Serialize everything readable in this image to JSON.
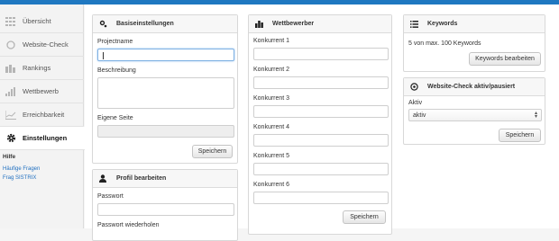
{
  "sidebar": {
    "items": [
      {
        "label": "Übersicht",
        "icon": "grid-icon"
      },
      {
        "label": "Website-Check",
        "icon": "circle-icon"
      },
      {
        "label": "Rankings",
        "icon": "bars-icon"
      },
      {
        "label": "Wettbewerb",
        "icon": "column-chart-icon"
      },
      {
        "label": "Erreichbarkeit",
        "icon": "line-chart-icon"
      },
      {
        "label": "Einstellungen",
        "icon": "gear-icon"
      }
    ],
    "help_heading": "Hilfe",
    "help_links": [
      "Häufige Fragen",
      "Frag SISTRIX"
    ]
  },
  "basis": {
    "title": "Basiseinstellungen",
    "projectname_label": "Projectname",
    "beschreibung_label": "Beschreibung",
    "eigene_seite_label": "Eigene Seite",
    "save_label": "Speichern"
  },
  "profil": {
    "title": "Profil bearbeiten",
    "passwort_label": "Passwort",
    "passwort_repeat_label": "Passwort wiederholen"
  },
  "wettbewerber": {
    "title": "Wettbewerber",
    "labels": [
      "Konkurrent 1",
      "Konkurrent 2",
      "Konkurrent 3",
      "Konkurrent 4",
      "Konkurrent 5",
      "Konkurrent 6"
    ],
    "save_label": "Speichern"
  },
  "keywords": {
    "title": "Keywords",
    "text": "5 von max. 100 Keywords",
    "button_label": "Keywords bearbeiten"
  },
  "website_check": {
    "title": "Website-Check aktiv/pausiert",
    "aktiv_label": "Aktiv",
    "selected": "aktiv",
    "save_label": "Speichern"
  },
  "colors": {
    "topbar": "#1f78c1",
    "link": "#1f6fc0"
  }
}
